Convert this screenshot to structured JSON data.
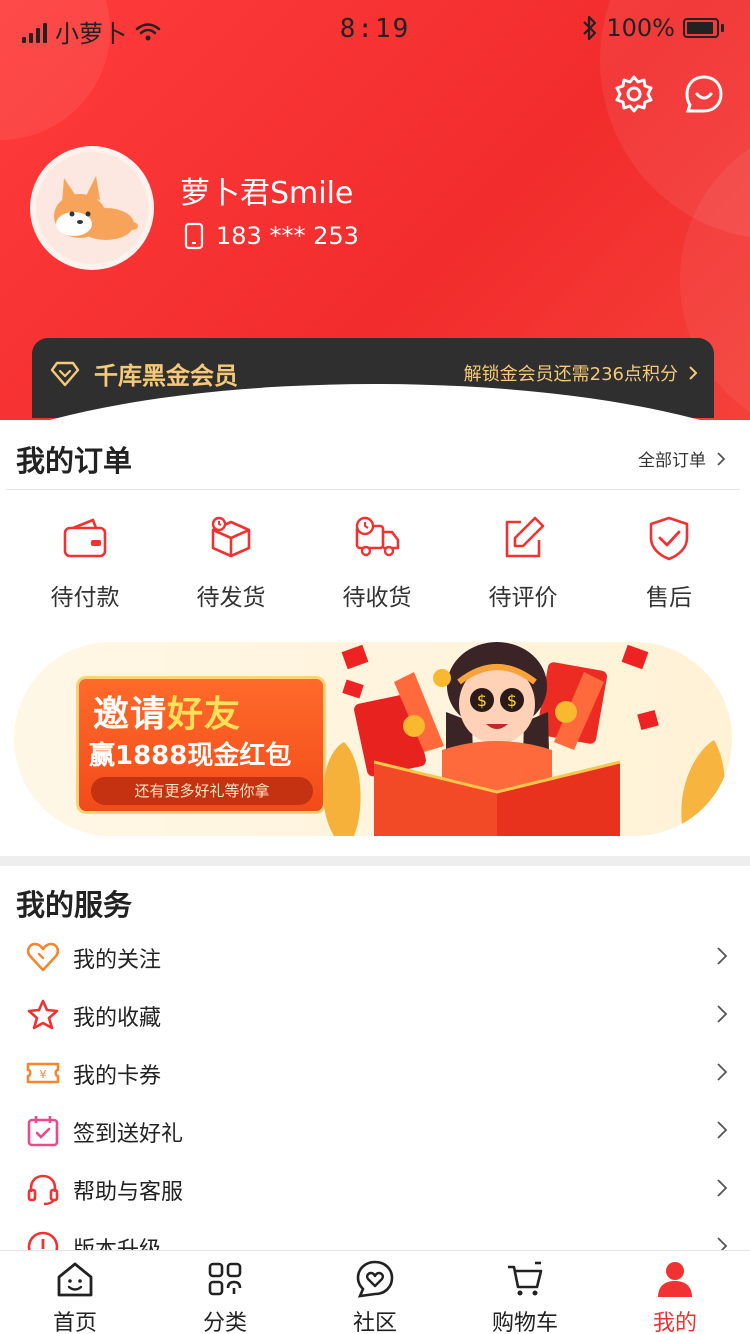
{
  "status_bar": {
    "carrier": "小萝卜",
    "time": "8:19",
    "battery": "100%"
  },
  "profile": {
    "name": "萝卜君Smile",
    "phone": "183 *** 253"
  },
  "vip": {
    "title": "千库黑金会员",
    "hint": "解锁金会员还需236点积分"
  },
  "orders": {
    "title": "我的订单",
    "all_label": "全部订单",
    "items": [
      {
        "label": "待付款",
        "icon": "wallet-icon"
      },
      {
        "label": "待发货",
        "icon": "box-icon"
      },
      {
        "label": "待收货",
        "icon": "truck-icon"
      },
      {
        "label": "待评价",
        "icon": "edit-icon"
      },
      {
        "label": "售后",
        "icon": "shield-icon"
      }
    ]
  },
  "banner": {
    "title_main": "邀请",
    "title_highlight": "好友",
    "subtitle": "赢1888现金红包",
    "footer": "还有更多好礼等你拿"
  },
  "services": {
    "title": "我的服务",
    "items": [
      {
        "label": "我的关注",
        "icon": "heart-icon"
      },
      {
        "label": "我的收藏",
        "icon": "star-icon"
      },
      {
        "label": "我的卡券",
        "icon": "coupon-icon"
      },
      {
        "label": "签到送好礼",
        "icon": "calendar-check-icon"
      },
      {
        "label": "帮助与客服",
        "icon": "headset-icon"
      },
      {
        "label": "版本升级",
        "icon": "info-icon"
      }
    ]
  },
  "tabbar": {
    "items": [
      {
        "label": "首页",
        "icon": "home-icon"
      },
      {
        "label": "分类",
        "icon": "grid-icon"
      },
      {
        "label": "社区",
        "icon": "community-icon"
      },
      {
        "label": "购物车",
        "icon": "cart-icon"
      },
      {
        "label": "我的",
        "icon": "user-icon",
        "active": true
      }
    ]
  },
  "colors": {
    "primary": "#f03232",
    "gold": "#f4c97a",
    "vip_bg": "#2f2f2f"
  }
}
